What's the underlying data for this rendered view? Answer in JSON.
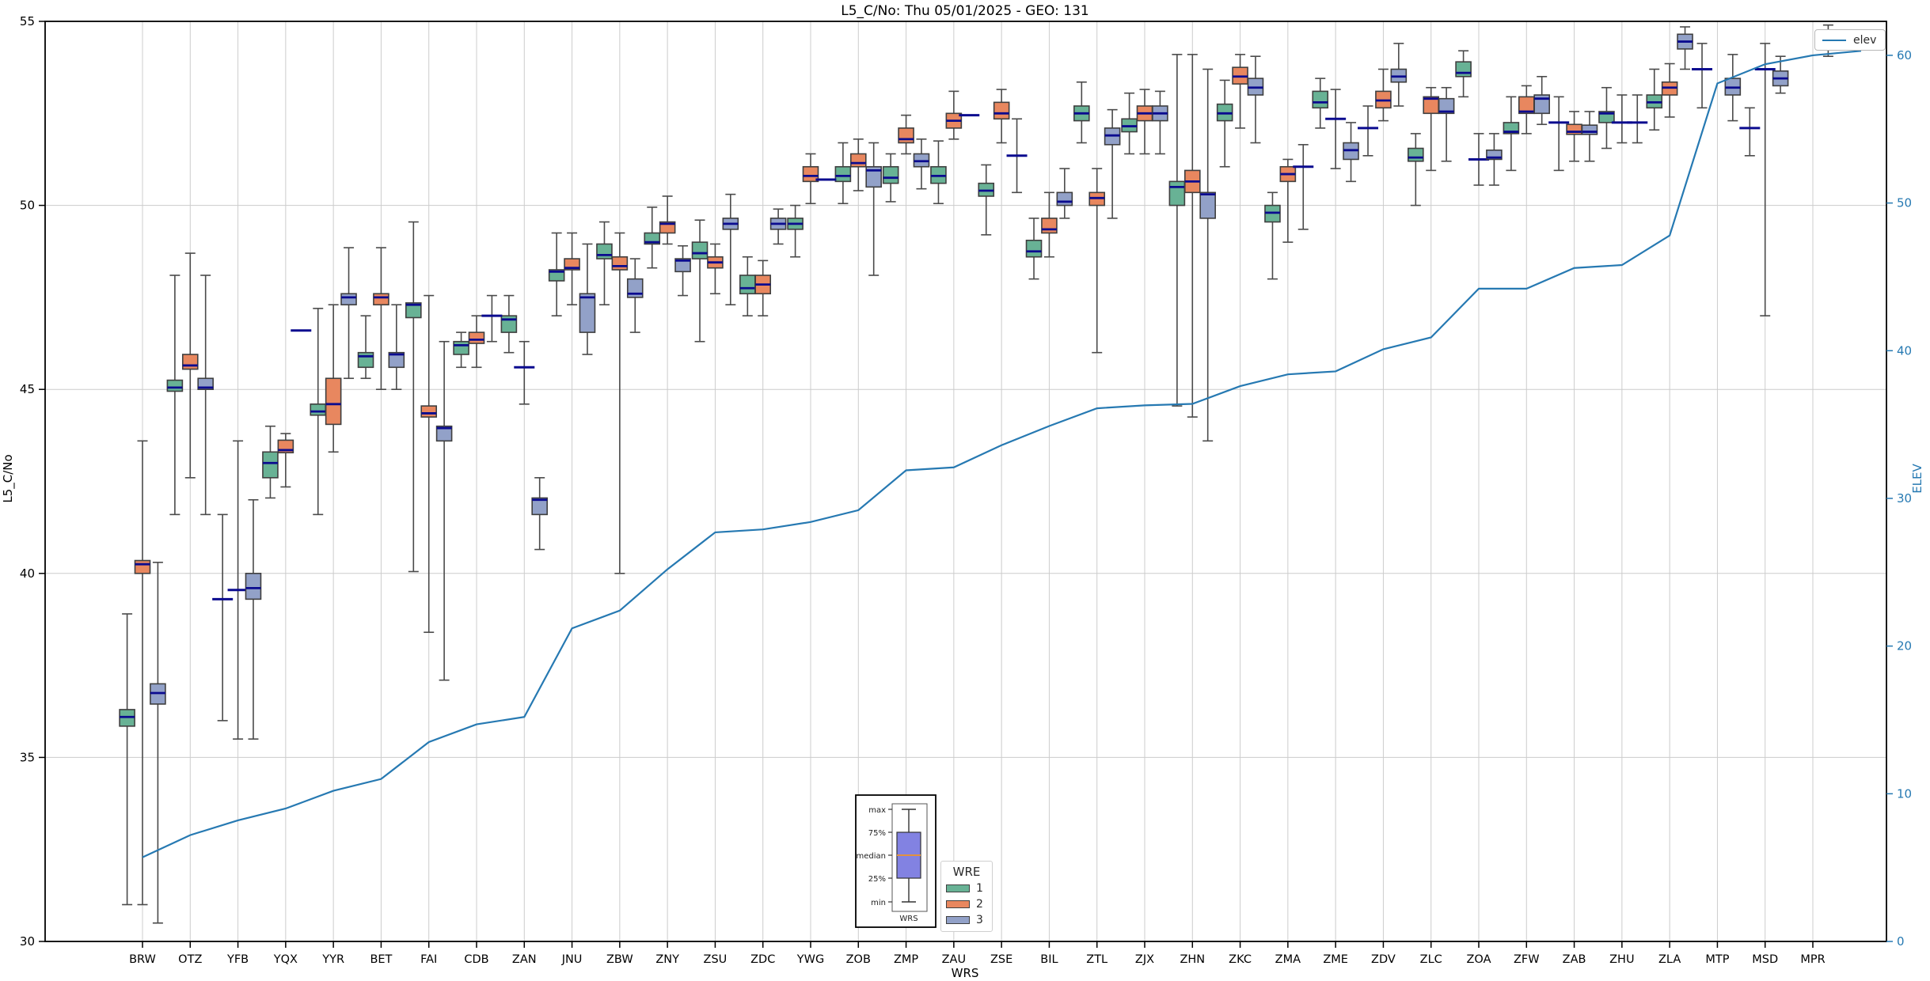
{
  "chart_data": {
    "type": "bar",
    "subtype": "grouped-boxplot-with-line",
    "title": "L5_C/No: Thu 05/01/2025 - GEO: 131",
    "xlabel": "WRS",
    "ylabel_left": "L5_C/No",
    "ylabel_right": "ELEV",
    "ylim_left": [
      30,
      55
    ],
    "yticks_left": [
      30,
      35,
      40,
      45,
      50,
      55
    ],
    "ylim_right": [
      0,
      62.3
    ],
    "yticks_right": [
      0,
      10,
      20,
      30,
      40,
      50,
      60
    ],
    "grid": true,
    "legend_position": "upper-right (line), lower-center (hue)",
    "categories": [
      "BRW",
      "OTZ",
      "YFB",
      "YQX",
      "YYR",
      "BET",
      "FAI",
      "CDB",
      "ZAN",
      "JNU",
      "ZBW",
      "ZNY",
      "ZSU",
      "ZDC",
      "YWG",
      "ZOB",
      "ZMP",
      "ZAU",
      "ZSE",
      "BIL",
      "ZTL",
      "ZJX",
      "ZHN",
      "ZKC",
      "ZMA",
      "ZME",
      "ZDV",
      "ZLC",
      "ZOA",
      "ZFW",
      "ZAB",
      "ZHU",
      "ZLA",
      "MTP",
      "MSD",
      "MPR"
    ],
    "box_value_order": [
      "median",
      "q1",
      "q3",
      "whisker_low",
      "whisker_high"
    ],
    "series": [
      {
        "name": "1",
        "color": "#68b295",
        "boxes": [
          [
            36.1,
            35.85,
            36.3,
            31.0,
            38.9
          ],
          [
            45.05,
            44.95,
            45.25,
            41.6,
            48.1
          ],
          [
            39.3,
            39.3,
            39.3,
            36.0,
            41.6
          ],
          [
            43.0,
            42.6,
            43.3,
            42.05,
            44.0
          ],
          [
            44.4,
            44.3,
            44.6,
            41.6,
            47.2
          ],
          [
            45.9,
            45.6,
            46.0,
            45.3,
            47.0
          ],
          [
            47.3,
            46.95,
            47.35,
            40.05,
            49.55
          ],
          [
            46.2,
            45.95,
            46.3,
            45.6,
            46.55
          ],
          [
            46.9,
            46.55,
            47.0,
            46.0,
            47.55
          ],
          [
            48.2,
            47.95,
            48.25,
            47.0,
            49.25
          ],
          [
            48.65,
            48.55,
            48.95,
            47.3,
            49.55
          ],
          [
            49.0,
            48.95,
            49.25,
            48.3,
            49.95
          ],
          [
            48.7,
            48.55,
            49.0,
            46.3,
            49.6
          ],
          [
            47.75,
            47.6,
            48.1,
            47.0,
            48.6
          ],
          [
            49.5,
            49.35,
            49.65,
            48.6,
            50.0
          ],
          [
            50.8,
            50.65,
            51.05,
            50.05,
            51.7
          ],
          [
            50.75,
            50.6,
            51.05,
            50.1,
            51.4
          ],
          [
            50.8,
            50.6,
            51.05,
            50.05,
            51.75
          ],
          [
            50.4,
            50.25,
            50.6,
            49.2,
            51.1
          ],
          [
            48.75,
            48.6,
            49.05,
            48.0,
            49.65
          ],
          [
            52.5,
            52.3,
            52.7,
            51.7,
            53.35
          ],
          [
            52.15,
            52.0,
            52.35,
            51.4,
            53.05
          ],
          [
            50.5,
            50.0,
            50.65,
            44.55,
            54.1
          ],
          [
            52.5,
            52.3,
            52.75,
            51.05,
            53.4
          ],
          [
            49.8,
            49.55,
            50.0,
            48.0,
            50.35
          ],
          [
            52.8,
            52.65,
            53.1,
            52.1,
            53.45
          ],
          [
            52.1,
            52.1,
            52.1,
            51.35,
            52.7
          ],
          [
            51.3,
            51.2,
            51.55,
            50.0,
            51.95
          ],
          [
            53.6,
            53.5,
            53.9,
            52.95,
            54.2
          ],
          [
            52.0,
            51.95,
            52.25,
            50.95,
            52.95
          ],
          [
            52.25,
            52.25,
            52.25,
            50.95,
            52.95
          ],
          [
            52.5,
            52.25,
            52.55,
            51.55,
            53.2
          ],
          [
            52.8,
            52.65,
            53.0,
            52.05,
            53.7
          ],
          [
            53.7,
            53.7,
            53.7,
            52.65,
            54.4
          ],
          [
            52.1,
            52.1,
            52.1,
            51.35,
            52.65
          ],
          null
        ]
      },
      {
        "name": "2",
        "color": "#e8875f",
        "boxes": [
          [
            40.25,
            40.0,
            40.35,
            31.0,
            43.6
          ],
          [
            45.65,
            45.55,
            45.95,
            42.6,
            48.7
          ],
          [
            39.55,
            39.55,
            39.55,
            35.5,
            43.6
          ],
          [
            43.35,
            43.28,
            43.62,
            42.35,
            43.8
          ],
          [
            44.6,
            44.05,
            45.3,
            43.3,
            47.3
          ],
          [
            47.5,
            47.3,
            47.6,
            45.0,
            48.85
          ],
          [
            44.35,
            44.25,
            44.55,
            38.4,
            47.55
          ],
          [
            46.35,
            46.25,
            46.55,
            45.6,
            47.0
          ],
          [
            45.6,
            45.6,
            45.6,
            44.6,
            46.3
          ],
          [
            48.3,
            48.25,
            48.55,
            47.3,
            49.25
          ],
          [
            48.35,
            48.25,
            48.6,
            40.0,
            49.25
          ],
          [
            49.5,
            49.25,
            49.55,
            48.95,
            50.25
          ],
          [
            48.45,
            48.3,
            48.6,
            47.6,
            48.95
          ],
          [
            47.85,
            47.6,
            48.1,
            47.0,
            48.5
          ],
          [
            50.8,
            50.65,
            51.05,
            50.05,
            51.4
          ],
          [
            51.15,
            51.05,
            51.4,
            50.4,
            51.8
          ],
          [
            51.8,
            51.7,
            52.1,
            51.4,
            52.45
          ],
          [
            52.3,
            52.1,
            52.5,
            51.8,
            53.1
          ],
          [
            52.5,
            52.35,
            52.8,
            51.7,
            53.15
          ],
          [
            49.35,
            49.25,
            49.65,
            48.6,
            50.35
          ],
          [
            50.2,
            50.0,
            50.35,
            46.0,
            51.0
          ],
          [
            52.5,
            52.3,
            52.7,
            51.4,
            53.15
          ],
          [
            50.65,
            50.35,
            50.95,
            44.25,
            54.1
          ],
          [
            53.5,
            53.3,
            53.75,
            52.1,
            54.1
          ],
          [
            50.85,
            50.65,
            51.05,
            49.0,
            51.25
          ],
          [
            52.35,
            52.35,
            52.35,
            51.0,
            53.15
          ],
          [
            52.85,
            52.65,
            53.1,
            52.3,
            53.7
          ],
          [
            52.9,
            52.5,
            52.95,
            50.95,
            53.2
          ],
          [
            51.25,
            51.25,
            51.25,
            50.55,
            51.95
          ],
          [
            52.55,
            52.5,
            52.95,
            51.95,
            53.25
          ],
          [
            52.0,
            51.93,
            52.2,
            51.2,
            52.55
          ],
          [
            52.25,
            52.25,
            52.25,
            51.7,
            53.0
          ],
          [
            53.2,
            53.0,
            53.35,
            52.4,
            53.85
          ],
          null,
          [
            53.7,
            53.7,
            53.7,
            47.0,
            54.4
          ],
          null
        ]
      },
      {
        "name": "3",
        "color": "#92a1c8",
        "boxes": [
          [
            36.75,
            36.45,
            37.0,
            30.5,
            40.3
          ],
          [
            45.05,
            45.0,
            45.3,
            41.6,
            48.1
          ],
          [
            39.6,
            39.3,
            40.0,
            35.5,
            42.0
          ],
          [
            46.6,
            46.6,
            46.6,
            46.6,
            46.6
          ],
          [
            47.5,
            47.3,
            47.6,
            45.3,
            48.85
          ],
          [
            45.95,
            45.6,
            46.0,
            45.0,
            47.3
          ],
          [
            43.95,
            43.6,
            44.0,
            37.1,
            46.3
          ],
          [
            47.0,
            47.0,
            47.0,
            46.3,
            47.55
          ],
          [
            42.0,
            41.6,
            42.05,
            40.65,
            42.6
          ],
          [
            47.5,
            46.55,
            47.6,
            45.95,
            48.95
          ],
          [
            47.6,
            47.5,
            48.0,
            46.55,
            48.55
          ],
          [
            48.5,
            48.2,
            48.55,
            47.55,
            48.9
          ],
          [
            49.5,
            49.35,
            49.65,
            47.3,
            50.3
          ],
          [
            49.5,
            49.35,
            49.65,
            48.95,
            49.9
          ],
          [
            50.7,
            50.7,
            50.7,
            50.7,
            50.7
          ],
          [
            50.95,
            50.5,
            51.05,
            48.1,
            51.7
          ],
          [
            51.2,
            51.05,
            51.4,
            50.45,
            51.8
          ],
          [
            52.45,
            52.45,
            52.45,
            52.45,
            52.45
          ],
          [
            51.35,
            51.35,
            51.35,
            50.35,
            52.35
          ],
          [
            50.1,
            50.0,
            50.35,
            49.65,
            51.0
          ],
          [
            51.9,
            51.65,
            52.1,
            49.65,
            52.6
          ],
          [
            52.5,
            52.3,
            52.7,
            51.4,
            53.1
          ],
          [
            50.3,
            49.65,
            50.35,
            43.6,
            53.7
          ],
          [
            53.2,
            53.0,
            53.45,
            51.7,
            54.05
          ],
          [
            51.05,
            51.05,
            51.05,
            49.35,
            51.65
          ],
          [
            51.5,
            51.25,
            51.7,
            50.65,
            52.25
          ],
          [
            53.5,
            53.35,
            53.7,
            52.7,
            54.4
          ],
          [
            52.55,
            52.5,
            52.9,
            51.2,
            53.2
          ],
          [
            51.3,
            51.25,
            51.5,
            50.55,
            51.95
          ],
          [
            52.9,
            52.5,
            53.0,
            52.2,
            53.5
          ],
          [
            52.0,
            51.93,
            52.18,
            51.2,
            52.55
          ],
          [
            52.25,
            52.25,
            52.25,
            51.7,
            53.0
          ],
          [
            54.45,
            54.25,
            54.65,
            53.7,
            54.85
          ],
          [
            53.2,
            53.0,
            53.45,
            52.3,
            54.1
          ],
          [
            53.45,
            53.25,
            53.65,
            53.05,
            54.05
          ],
          [
            54.55,
            54.3,
            54.75,
            54.05,
            54.9
          ]
        ]
      }
    ],
    "line_series": {
      "name": "elev",
      "color": "#2679b2",
      "axis": "right",
      "values": [
        5.7,
        7.2,
        8.2,
        9.0,
        10.2,
        11.0,
        13.5,
        14.7,
        15.2,
        21.2,
        22.4,
        25.2,
        27.7,
        27.9,
        28.4,
        29.2,
        31.9,
        32.1,
        33.6,
        34.9,
        36.1,
        36.3,
        36.4,
        37.6,
        38.4,
        38.6,
        40.1,
        40.9,
        44.2,
        44.2,
        45.6,
        45.8,
        47.8,
        58.1,
        59.4,
        60.0
      ],
      "extend_right_value": 60.3
    },
    "legend_line": {
      "label": "elev"
    },
    "legend_wre": {
      "title": "WRE",
      "entries": [
        {
          "label": "1",
          "color": "#68b295"
        },
        {
          "label": "2",
          "color": "#e8875f"
        },
        {
          "label": "3",
          "color": "#92a1c8"
        }
      ]
    },
    "inset_legend": {
      "labels": [
        "max",
        "75%",
        "median",
        "25%",
        "min"
      ],
      "xlabel": "WRS",
      "box_color": "#8282e2",
      "median_color": "#e2913f"
    },
    "colors": {
      "median": "#0b0b8f",
      "box_edge": "#3f3f3f",
      "whisker": "#4a4a4a",
      "grid": "#cccccc",
      "spine": "#000000",
      "right_axis_text": "#2679b2",
      "left_axis_text": "#000000"
    }
  }
}
